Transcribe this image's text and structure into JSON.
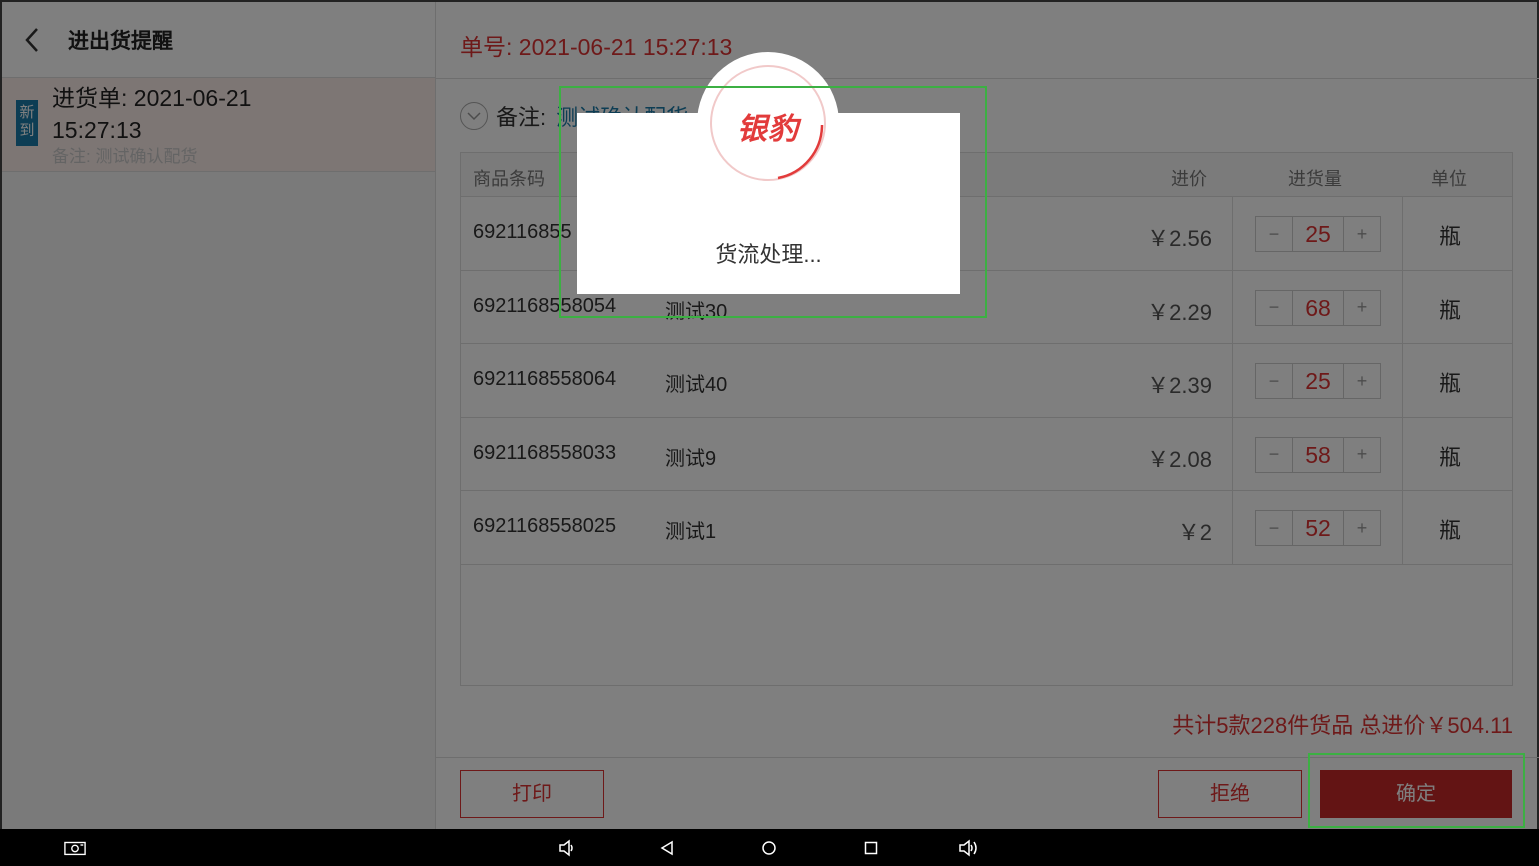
{
  "left": {
    "title": "进出货提醒",
    "order": {
      "badge": "新到",
      "title": "进货单: 2021-06-21 15:27:13",
      "note": "备注: 测试确认配货"
    }
  },
  "right": {
    "order_no": "单号: 2021-06-21 15:27:13",
    "remark_label": "备注:",
    "remark_value": "测试确认配货",
    "table": {
      "headers": {
        "barcode": "商品条码",
        "price": "进价",
        "qty": "进货量",
        "unit": "单位"
      },
      "rows": [
        {
          "barcode": "6921168558xxx",
          "barcode_display": "692116855",
          "name": "",
          "price": "￥2.56",
          "qty": "25",
          "unit": "瓶"
        },
        {
          "barcode": "6921168558054",
          "name": "测试30",
          "price": "￥2.29",
          "qty": "68",
          "unit": "瓶"
        },
        {
          "barcode": "6921168558064",
          "name": "测试40",
          "price": "￥2.39",
          "qty": "25",
          "unit": "瓶"
        },
        {
          "barcode": "6921168558033",
          "name": "测试9",
          "price": "￥2.08",
          "qty": "58",
          "unit": "瓶"
        },
        {
          "barcode": "6921168558025",
          "name": "测试1",
          "price": "￥2",
          "qty": "52",
          "unit": "瓶"
        }
      ]
    },
    "summary": "共计5款228件货品 总进价￥504.11",
    "buttons": {
      "print": "打印",
      "reject": "拒绝",
      "confirm": "确定"
    }
  },
  "loading": {
    "logo": "银豹",
    "text": "货流处理..."
  },
  "stepper": {
    "minus": "−",
    "plus": "+"
  },
  "colors": {
    "accent": "#d33333",
    "confirm": "#c62828",
    "badge": "#1a7aa8",
    "highlight": "#3cb043"
  }
}
